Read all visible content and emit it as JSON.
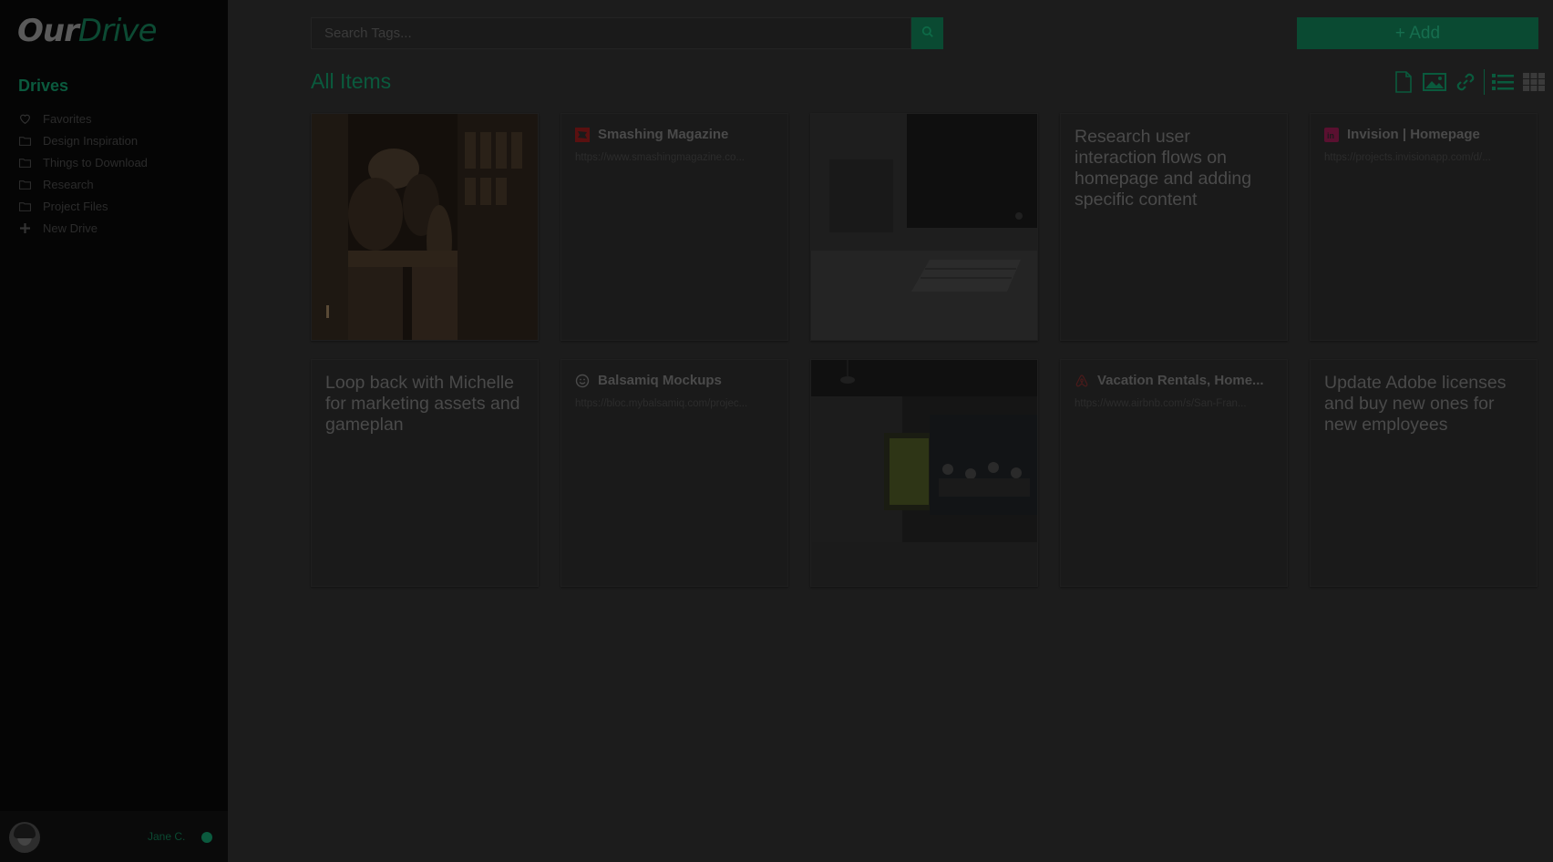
{
  "app": {
    "logo_part1": "Our",
    "logo_part2": "Drive"
  },
  "sidebar": {
    "drives_title": "Drives",
    "items": [
      {
        "label": "Favorites",
        "icon": "heart-icon"
      },
      {
        "label": "Design Inspiration",
        "icon": "folder-icon"
      },
      {
        "label": "Things to Download",
        "icon": "folder-icon"
      },
      {
        "label": "Research",
        "icon": "folder-icon"
      },
      {
        "label": "Project Files",
        "icon": "folder-icon"
      },
      {
        "label": "New Drive",
        "icon": "plus-icon"
      }
    ]
  },
  "user": {
    "name": "Jane C."
  },
  "search": {
    "placeholder": "Search Tags..."
  },
  "header": {
    "add_label": "+ Add",
    "title": "All Items"
  },
  "toolbar": {
    "filters": [
      "document-icon",
      "image-icon",
      "link-icon"
    ],
    "views": [
      "list-view-icon",
      "grid-view-icon"
    ]
  },
  "cards": [
    {
      "type": "image",
      "scene": "people-at-bar-photo"
    },
    {
      "type": "link",
      "title": "Smashing Magazine",
      "url": "https://www.smashingmagazine.co...",
      "icon": "smashing-magazine-icon"
    },
    {
      "type": "image",
      "scene": "imac-desk-photo"
    },
    {
      "type": "note",
      "text": "Research user interaction flows on homepage and adding specific content"
    },
    {
      "type": "link",
      "title": "Invision | Homepage",
      "url": "https://projects.invisionapp.com/d/...",
      "icon": "invision-icon"
    },
    {
      "type": "note",
      "text": "Loop back with Michelle for marketing assets and gameplan"
    },
    {
      "type": "link",
      "title": "Balsamiq Mockups",
      "url": "https://bloc.mybalsamiq.com/projec...",
      "icon": "balsamiq-icon"
    },
    {
      "type": "image",
      "scene": "open-office-photo"
    },
    {
      "type": "link",
      "title": "Vacation Rentals, Home...",
      "url": "https://www.airbnb.com/s/San-Fran...",
      "icon": "airbnb-icon"
    },
    {
      "type": "note",
      "text": "Update Adobe licenses and buy new ones for new employees"
    }
  ]
}
